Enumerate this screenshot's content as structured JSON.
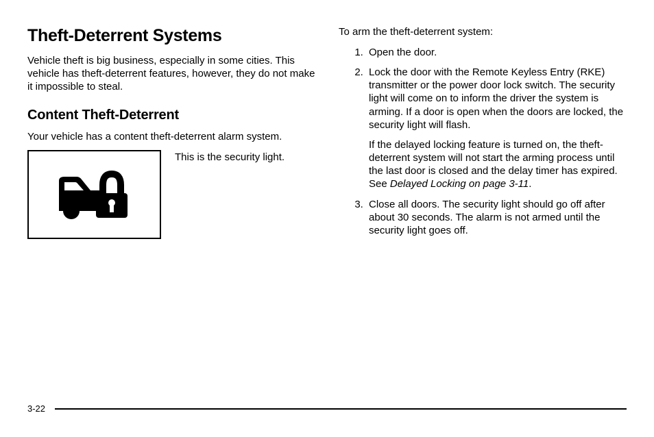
{
  "left": {
    "heading1": "Theft-Deterrent Systems",
    "intro": "Vehicle theft is big business, especially in some cities. This vehicle has theft-deterrent features, however, they do not make it impossible to steal.",
    "heading2": "Content Theft-Deterrent",
    "para2": "Your vehicle has a content theft-deterrent alarm system.",
    "fig_caption": "This is the security light."
  },
  "right": {
    "lead": "To arm the theft-deterrent system:",
    "steps": {
      "s1": "Open the door.",
      "s2a": "Lock the door with the Remote Keyless Entry (RKE) transmitter or the power door lock switch. The security light will come on to inform the driver the system is arming. If a door is open when the doors are locked, the security light will flash.",
      "s2b_pre": "If the delayed locking feature is turned on, the theft-deterrent system will not start the arming process until the last door is closed and the delay timer has expired. See ",
      "s2b_ref": "Delayed Locking on page 3-11",
      "s2b_post": ".",
      "s3": "Close all doors. The security light should go off after about 30 seconds. The alarm is not armed until the security light goes off."
    }
  },
  "page_number": "3-22"
}
